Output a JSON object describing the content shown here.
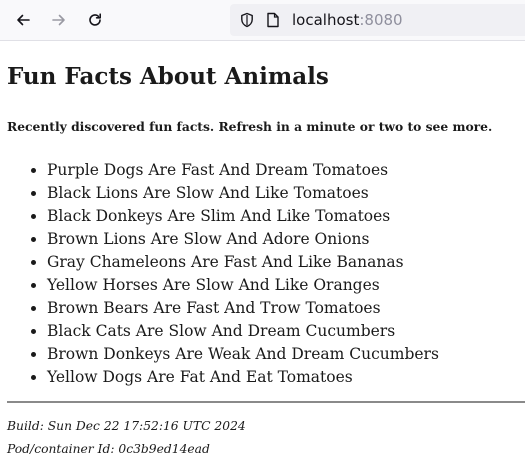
{
  "browser": {
    "url_host": "localhost",
    "url_port": ":8080",
    "icons": [
      "back-arrow-icon",
      "forward-arrow-icon",
      "reload-icon",
      "shield-icon",
      "page-icon"
    ]
  },
  "page": {
    "title": "Fun Facts About Animals",
    "intro": "Recently discovered fun facts. Refresh in a minute or two to see more.",
    "facts": [
      "Purple Dogs Are Fast And Dream Tomatoes",
      "Black Lions Are Slow And Like Tomatoes",
      "Black Donkeys Are Slim And Like Tomatoes",
      "Brown Lions Are Slow And Adore Onions",
      "Gray Chameleons Are Fast And Like Bananas",
      "Yellow Horses Are Slow And Like Oranges",
      "Brown Bears Are Fast And Trow Tomatoes",
      "Black Cats Are Slow And Dream Cucumbers",
      "Brown Donkeys Are Weak And Dream Cucumbers",
      "Yellow Dogs Are Fat And Eat Tomatoes"
    ],
    "build": "Build: Sun Dec 22 17:52:16 UTC 2024",
    "pod": "Pod/container Id: 0c3b9ed14ead"
  }
}
